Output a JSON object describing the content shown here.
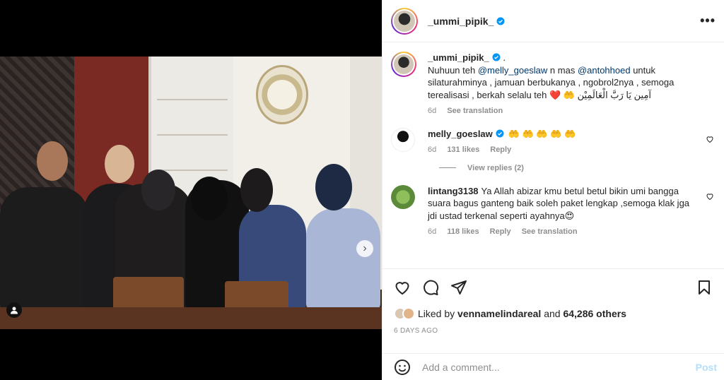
{
  "post": {
    "username": "_ummi_pipik_",
    "more_label": "•••"
  },
  "caption": {
    "username": "_ummi_pipik_",
    "dot": ".",
    "text_parts": [
      "Nuhuun teh ",
      "@melly_goeslaw",
      " n mas ",
      "@antohhoed",
      " untuk silaturahminya , jamuan berbukanya , ngobrol2nya , semoga terealisasi , berkah selalu teh ❤️ 🤲 آمِين يَا رَبَّ الْعَالَمِيْن"
    ],
    "age": "6d",
    "see_translation": "See translation"
  },
  "comments": [
    {
      "username": "melly_goeslaw",
      "text": "🤲 🤲 🤲 🤲 🤲",
      "age": "6d",
      "likes": "131 likes",
      "reply": "Reply",
      "view_replies": "View replies (2)"
    },
    {
      "username": "lintang3138",
      "text": "Ya Allah abizar kmu betul betul bikin umi bangga suara bagus ganteng baik soleh paket lengkap ,semoga klak jga jdi ustad terkenal seperti ayahnya😍",
      "age": "6d",
      "likes": "118 likes",
      "reply": "Reply",
      "see_translation": "See translation"
    }
  ],
  "likes": {
    "prefix": "Liked by ",
    "user": "vennamelindareal",
    "middle": " and ",
    "others": "64,286 others"
  },
  "timestamp": "6 DAYS AGO",
  "add_comment": {
    "placeholder": "Add a comment...",
    "post_label": "Post"
  },
  "icons": {
    "verified": "verified-badge-icon",
    "like": "heart-icon",
    "comment": "comment-icon",
    "share": "share-icon",
    "save": "bookmark-icon",
    "emoji": "emoji-icon",
    "next": "chevron-right-icon",
    "tag": "user-tag-icon"
  },
  "colors": {
    "verified_blue": "#0095f6",
    "mention": "#00376b",
    "post_button": "#b2dffc"
  }
}
